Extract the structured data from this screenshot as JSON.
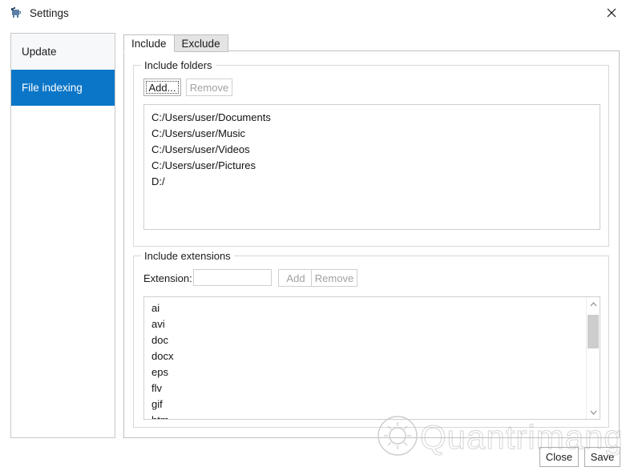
{
  "window": {
    "title": "Settings",
    "icon": "app-gear-icon",
    "close_label": "✕",
    "accent_color": "#0b76c8"
  },
  "sidebar": {
    "items": [
      {
        "label": "Update",
        "selected": false
      },
      {
        "label": "File indexing",
        "selected": true
      }
    ]
  },
  "tabs": [
    {
      "label": "Include",
      "active": true
    },
    {
      "label": "Exclude",
      "active": false
    }
  ],
  "include_folders": {
    "group_title": "Include folders",
    "add_label": "Add...",
    "remove_label": "Remove",
    "add_enabled": true,
    "remove_enabled": false,
    "items": [
      "C:/Users/user/Documents",
      "C:/Users/user/Music",
      "C:/Users/user/Videos",
      "C:/Users/user/Pictures",
      "D:/"
    ]
  },
  "include_extensions": {
    "group_title": "Include extensions",
    "field_label": "Extension:",
    "field_value": "",
    "field_placeholder": "",
    "add_label": "Add",
    "remove_label": "Remove",
    "add_enabled": false,
    "remove_enabled": false,
    "items": [
      "ai",
      "avi",
      "doc",
      "docx",
      "eps",
      "flv",
      "gif",
      "htm"
    ],
    "scrollbar": {
      "up_arrow": "⌃",
      "down_arrow": "⌄"
    }
  },
  "footer": {
    "close_label": "Close",
    "save_label": "Save"
  },
  "watermark": {
    "text": "Quantrimang"
  }
}
